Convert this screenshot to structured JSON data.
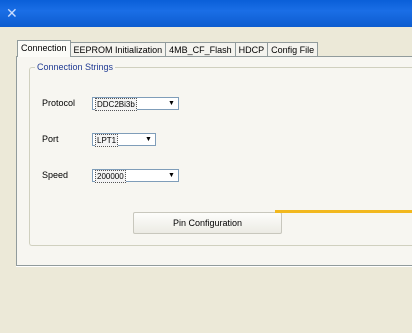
{
  "window": {
    "title_icon": "x-close-icon"
  },
  "tabs": [
    {
      "label": "Connection",
      "active": true
    },
    {
      "label": "EEPROM Initialization"
    },
    {
      "label": "4MB_CF_Flash"
    },
    {
      "label": "HDCP"
    },
    {
      "label": "Config File"
    }
  ],
  "group": {
    "title": "Connection Strings"
  },
  "fields": {
    "protocol_label": "Protocol",
    "protocol_value": "DDC2Bi3b",
    "port_label": "Port",
    "port_value": "LPT1",
    "speed_label": "Speed",
    "speed_value": "200000"
  },
  "buttons": {
    "pin_config": "Pin Configuration"
  },
  "colors": {
    "titlebar": "#0a5fd8",
    "highlight_line": "#f2b81e"
  }
}
